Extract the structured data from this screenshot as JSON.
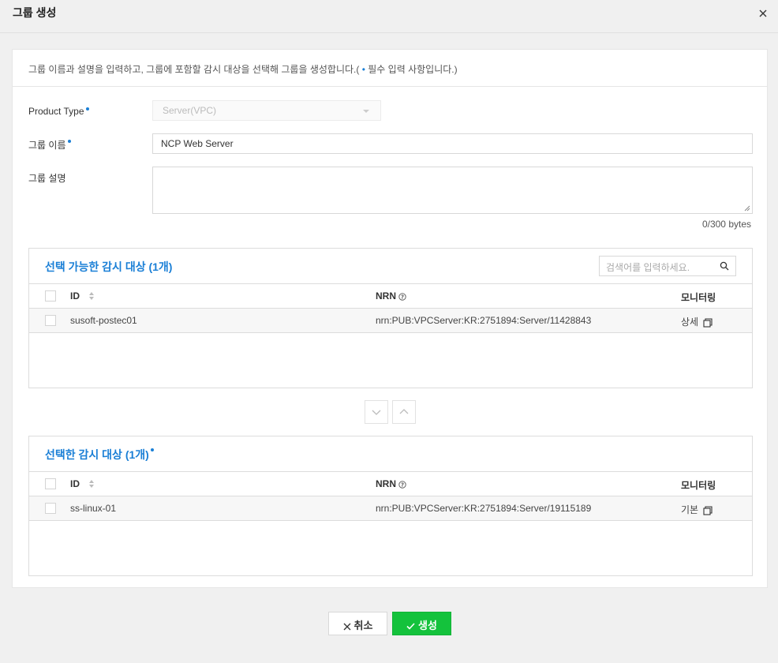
{
  "modal": {
    "title": "그룹 생성"
  },
  "description": {
    "text_before": "그룹 이름과 설명을 입력하고, 그룹에 포함할 감시 대상을 선택해 그룹을 생성합니다.( ",
    "dot": "•",
    "text_after": " 필수 입력 사항입니다.)"
  },
  "form": {
    "product_type_label": "Product Type",
    "product_type_value": "Server(VPC)",
    "group_name_label": "그룹 이름",
    "group_name_value": "NCP Web Server",
    "group_desc_label": "그룹 설명",
    "bytes_counter": "0/300 bytes"
  },
  "available": {
    "title": "선택 가능한 감시 대상 (1개)",
    "search_placeholder": "검색어를 입력하세요.",
    "columns": {
      "id": "ID",
      "nrn": "NRN",
      "monitoring": "모니터링"
    },
    "rows": [
      {
        "id": "susoft-postec01",
        "nrn": "nrn:PUB:VPCServer:KR:2751894:Server/11428843",
        "monitoring": "상세"
      }
    ]
  },
  "selected": {
    "title": "선택한 감시 대상 (1개)",
    "columns": {
      "id": "ID",
      "nrn": "NRN",
      "monitoring": "모니터링"
    },
    "rows": [
      {
        "id": "ss-linux-01",
        "nrn": "nrn:PUB:VPCServer:KR:2751894:Server/19115189",
        "monitoring": "기본"
      }
    ]
  },
  "footer": {
    "cancel_label": "취소",
    "create_label": "생성"
  },
  "colors": {
    "accent": "#1a7fd6",
    "create": "#14c23c"
  }
}
